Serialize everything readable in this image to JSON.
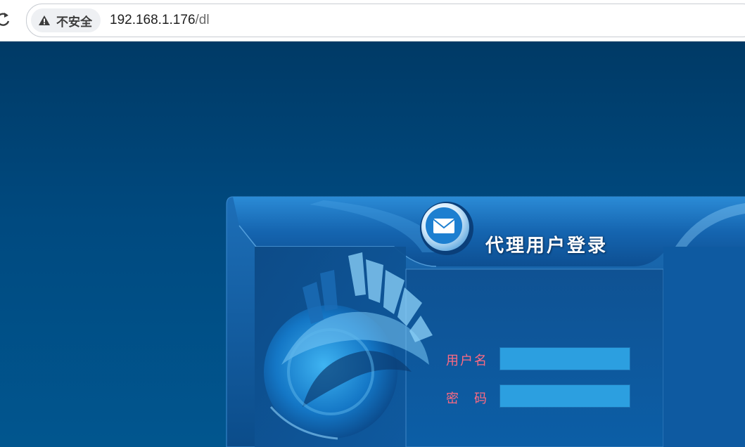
{
  "browser": {
    "security_label": "不安全",
    "url_host": "192.168.1.176",
    "url_path": "/dl"
  },
  "login": {
    "title": "代理用户登录",
    "username_label": "用户名",
    "password_label_first": "密",
    "password_label_second": "码",
    "username_value": "",
    "password_value": ""
  },
  "colors": {
    "background": "#004a80",
    "panel": "#0d4f8c",
    "label": "#ff6a82",
    "input": "#2c9fe0"
  },
  "icons": {
    "security": "warning-triangle-icon",
    "reload": "reload-icon",
    "mail": "mail-envelope-icon"
  }
}
